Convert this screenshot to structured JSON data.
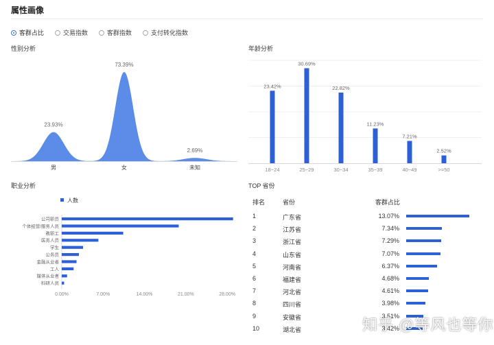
{
  "page": {
    "title": "属性画像"
  },
  "tabs": [
    {
      "label": "客群占比",
      "selected": true
    },
    {
      "label": "交易指数",
      "selected": false
    },
    {
      "label": "客群指数",
      "selected": false
    },
    {
      "label": "支付转化指数",
      "selected": false
    }
  ],
  "colors": {
    "accent": "#2d5fd6",
    "area_fill": "#5b8ce8",
    "axis": "#d8d8d8"
  },
  "gender": {
    "title": "性别分析",
    "chart_data": {
      "type": "area",
      "categories": [
        "男",
        "女",
        "未知"
      ],
      "values": [
        23.93,
        73.39,
        2.69
      ],
      "labels": [
        "23.93%",
        "73.39%",
        "2.69%"
      ],
      "unit": "%"
    }
  },
  "age": {
    "title": "年龄分析",
    "chart_data": {
      "type": "bar",
      "categories": [
        "18~24",
        "25~29",
        "30~34",
        "35~39",
        "40~49",
        ">=50"
      ],
      "values": [
        23.42,
        30.69,
        22.82,
        11.23,
        7.21,
        2.52
      ],
      "labels": [
        "23.42%",
        "30.69%",
        "22.82%",
        "11.23%",
        "7.21%",
        "2.52%"
      ],
      "ylim": [
        0,
        35
      ],
      "unit": "%"
    }
  },
  "occupation": {
    "title": "职业分析",
    "chart_data": {
      "type": "bar",
      "orientation": "horizontal",
      "legend": "人数",
      "categories": [
        "公司职员",
        "个体经营/服务人员",
        "教职工",
        "医务人员",
        "学生",
        "公务员",
        "金融从业者",
        "工人",
        "媒体从业者",
        "科研人员"
      ],
      "values": [
        29.0,
        19.8,
        10.4,
        6.2,
        3.6,
        2.9,
        2.5,
        2.0,
        0.9,
        0.4
      ],
      "xticks": [
        "0.00%",
        "7.00%",
        "14.00%",
        "21.00%",
        "28.00%"
      ],
      "xtick_values": [
        0,
        7,
        14,
        21,
        28
      ],
      "xlim": [
        0,
        29.5
      ],
      "unit": "%"
    }
  },
  "provinces": {
    "title": "TOP 省份",
    "headers": {
      "rank": "排名",
      "province": "省份",
      "share": "客群占比"
    },
    "chart_data": {
      "type": "table",
      "rows": [
        {
          "rank": "1",
          "province": "广东省",
          "share": "13.07%",
          "value": 13.07
        },
        {
          "rank": "2",
          "province": "江苏省",
          "share": "7.34%",
          "value": 7.34
        },
        {
          "rank": "3",
          "province": "浙江省",
          "share": "7.29%",
          "value": 7.29
        },
        {
          "rank": "4",
          "province": "山东省",
          "share": "7.07%",
          "value": 7.07
        },
        {
          "rank": "5",
          "province": "河南省",
          "share": "6.37%",
          "value": 6.37
        },
        {
          "rank": "6",
          "province": "福建省",
          "share": "4.68%",
          "value": 4.68
        },
        {
          "rank": "7",
          "province": "河北省",
          "share": "4.61%",
          "value": 4.61
        },
        {
          "rank": "8",
          "province": "四川省",
          "share": "3.98%",
          "value": 3.98
        },
        {
          "rank": "9",
          "province": "安徽省",
          "share": "3.51%",
          "value": 3.51
        },
        {
          "rank": "10",
          "province": "湖北省",
          "share": "3.42%",
          "value": 3.42
        }
      ]
    }
  },
  "watermark": "知乎 @等风也等你"
}
